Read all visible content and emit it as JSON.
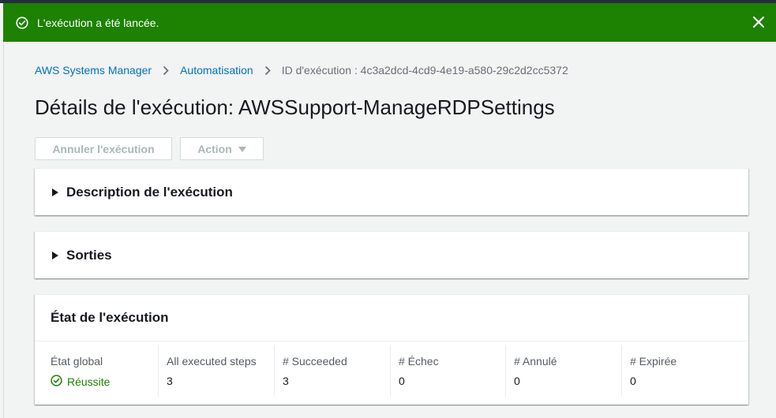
{
  "flash": {
    "message": "L'exécution a été lancée."
  },
  "breadcrumb": {
    "items": [
      {
        "label": "AWS Systems Manager"
      },
      {
        "label": "Automatisation"
      },
      {
        "label": "ID d'exécution : 4c3a2dcd-4cd9-4e19-a580-29c2d2cc5372"
      }
    ]
  },
  "page": {
    "title": "Détails de l'exécution: AWSSupport-ManageRDPSettings"
  },
  "toolbar": {
    "cancel_label": "Annuler l'exécution",
    "action_label": "Action"
  },
  "panels": {
    "description_title": "Description de l'exécution",
    "outputs_title": "Sorties",
    "status_title": "État de l'exécution"
  },
  "status": {
    "columns": [
      {
        "label": "État global",
        "value": "Réussite"
      },
      {
        "label": "All executed steps",
        "value": "3"
      },
      {
        "label": "# Succeeded",
        "value": "3"
      },
      {
        "label": "# Échec",
        "value": "0"
      },
      {
        "label": "# Annulé",
        "value": "0"
      },
      {
        "label": "# Expirée",
        "value": "0"
      }
    ]
  },
  "colors": {
    "success": "#1d8102",
    "link": "#0073bb",
    "disabled_text": "#aab7b8"
  },
  "icons": {
    "flash": "check-circle-icon",
    "close": "close-icon",
    "separator": "chevron-right-icon",
    "dropdown": "caret-down-icon",
    "expand": "caret-right-icon",
    "status": "check-circle-icon"
  }
}
